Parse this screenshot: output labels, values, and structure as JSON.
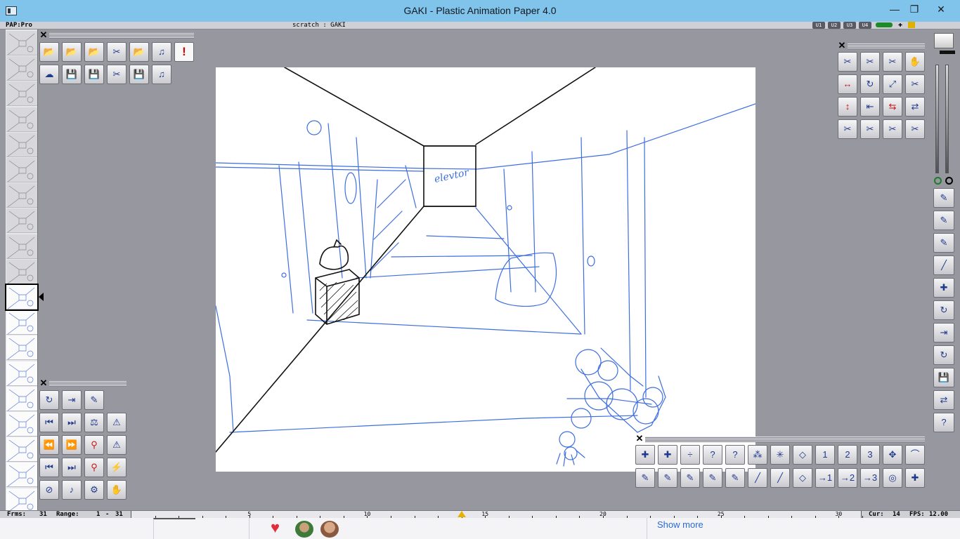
{
  "window": {
    "title": "GAKI - Plastic Animation Paper 4.0",
    "minimize": "—",
    "restore": "❐",
    "close": "✕"
  },
  "status": {
    "mode": "PAP:Pro",
    "scene": "scratch : GAKI",
    "user_buttons": [
      "U1",
      "U2",
      "U3",
      "U4"
    ]
  },
  "canvas": {
    "annotation": "elevtor"
  },
  "timeline": {
    "frames_label": "Frms:",
    "frames_value": "31",
    "range_label": "Range:",
    "range_start": "1",
    "range_end": "31",
    "ticks": [
      "5",
      "10",
      "15",
      "20",
      "25",
      "30"
    ],
    "current_frame": 14,
    "cur_label": "Cur:",
    "cur_value": "14",
    "fps_label": "FPS:",
    "fps_value": "12.00"
  },
  "bottom_bar": {
    "show_more": "Show more"
  },
  "palettes": {
    "close_glyph": "✕",
    "file_tools": {
      "row1": [
        "📂",
        "📂",
        "📂",
        "✂",
        "📂",
        "♫",
        "!"
      ],
      "row2": [
        "☁",
        "💾",
        "💾",
        "✂",
        "💾",
        "♫"
      ]
    },
    "playback_tools": {
      "rows": [
        [
          "↻",
          "⇥",
          "✎"
        ],
        [
          "⏮",
          "⏭",
          "⚖",
          "⚠"
        ],
        [
          "⏪",
          "⏩",
          "⚲",
          "⚠"
        ],
        [
          "⏮",
          "⏭",
          "⚲",
          "⚡"
        ],
        [
          "⊘",
          "♪",
          "⚙",
          "✋"
        ]
      ]
    },
    "edit_tools": {
      "rows": [
        [
          "✂",
          "✂",
          "✂",
          "✋"
        ],
        [
          "↔",
          "↻",
          "⤢",
          "✂"
        ],
        [
          "↕",
          "⇤",
          "⇆",
          "⇄"
        ],
        [
          "✂",
          "✂",
          "✂",
          "✂"
        ]
      ]
    },
    "draw_tools": {
      "row1": [
        "✚",
        "✚",
        "÷",
        "?",
        "?",
        "⁂",
        "✳",
        "◇",
        "1",
        "2",
        "3",
        "✥",
        "⌒"
      ],
      "row2": [
        "✎",
        "✎",
        "✎",
        "✎",
        "✎",
        "╱",
        "╱",
        "◇",
        "→1",
        "→2",
        "→3",
        "◎",
        "✚"
      ]
    },
    "right_tools": [
      "✎",
      "✎",
      "✎",
      "╱",
      "✚",
      "↻",
      "⇥",
      "↻",
      "💾",
      "⇄",
      "?"
    ]
  },
  "colors": {
    "window_accent": "#80c4ec",
    "workspace": "#97979f",
    "sketch_blue": "#3d6ee0",
    "ink_black": "#111111"
  }
}
